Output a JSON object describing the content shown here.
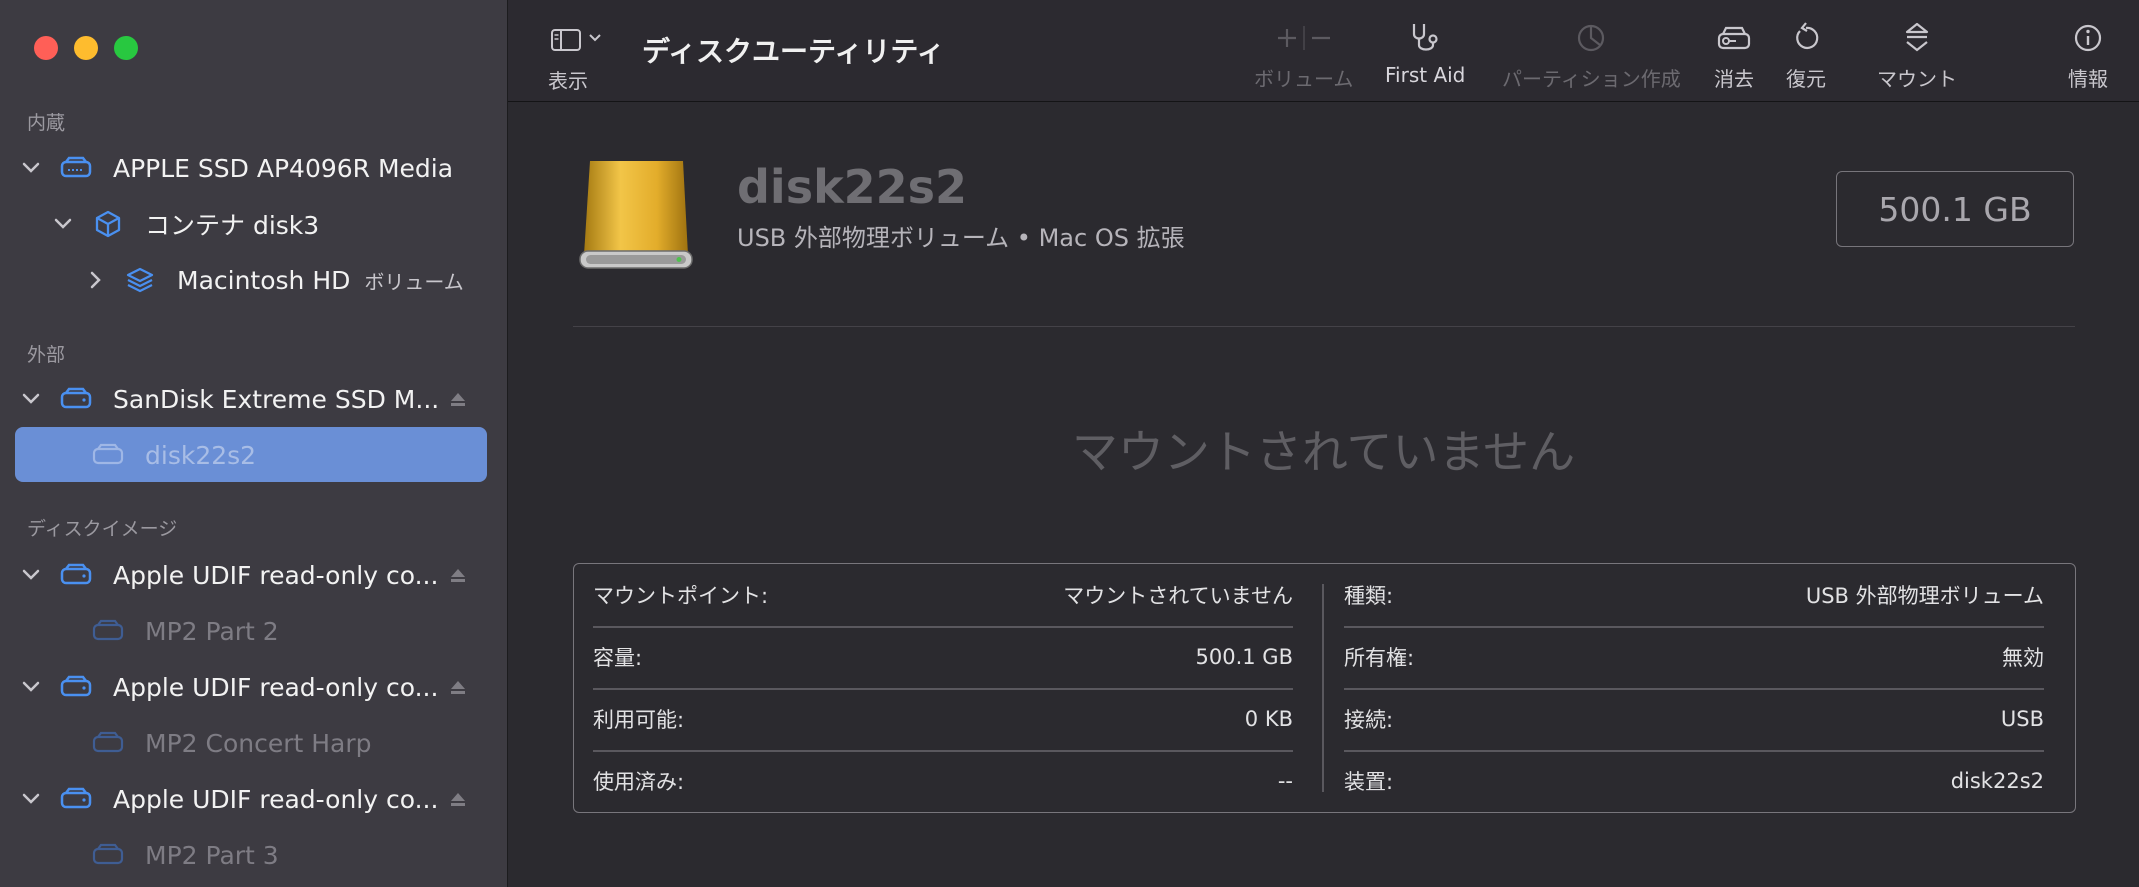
{
  "app": {
    "window_title": "ディスクユーティリティ"
  },
  "toolbar": {
    "view_label": "表示",
    "volume_label": "ボリューム",
    "first_aid_label": "First Aid",
    "partition_label": "パーティション作成",
    "erase_label": "消去",
    "restore_label": "復元",
    "mount_label": "マウント",
    "info_label": "情報"
  },
  "sidebar": {
    "sections": {
      "internal": "内蔵",
      "external": "外部",
      "disk_images": "ディスクイメージ"
    },
    "items": [
      {
        "label": "APPLE SSD AP4096R Media"
      },
      {
        "label": "コンテナ disk3"
      },
      {
        "label": "Macintosh HD",
        "sub": "ボリューム"
      },
      {
        "label": "SanDisk Extreme SSD M..."
      },
      {
        "label": "disk22s2"
      },
      {
        "label": "Apple UDIF read-only co..."
      },
      {
        "label": "MP2 Part 2"
      },
      {
        "label": "Apple UDIF read-only co..."
      },
      {
        "label": "MP2 Concert Harp"
      },
      {
        "label": "Apple UDIF read-only co..."
      },
      {
        "label": "MP2 Part 3"
      }
    ]
  },
  "main": {
    "disk_name": "disk22s2",
    "disk_description": "USB 外部物理ボリューム • Mac OS 拡張",
    "capacity": "500.1 GB",
    "status_big": "マウントされていません",
    "info": {
      "left": [
        {
          "key": "マウントポイント:",
          "value": "マウントされていません"
        },
        {
          "key": "容量:",
          "value": "500.1 GB"
        },
        {
          "key": "利用可能:",
          "value": "0 KB"
        },
        {
          "key": "使用済み:",
          "value": "--"
        }
      ],
      "right": [
        {
          "key": "種類:",
          "value": "USB 外部物理ボリューム"
        },
        {
          "key": "所有権:",
          "value": "無効"
        },
        {
          "key": "接続:",
          "value": "USB"
        },
        {
          "key": "装置:",
          "value": "disk22s2"
        }
      ]
    }
  },
  "colors": {
    "sidebar_bg": "#3d3b42",
    "selection": "#6a8fd6",
    "accent_icon": "#4a90f0",
    "main_bg": "#2b2a2f"
  }
}
